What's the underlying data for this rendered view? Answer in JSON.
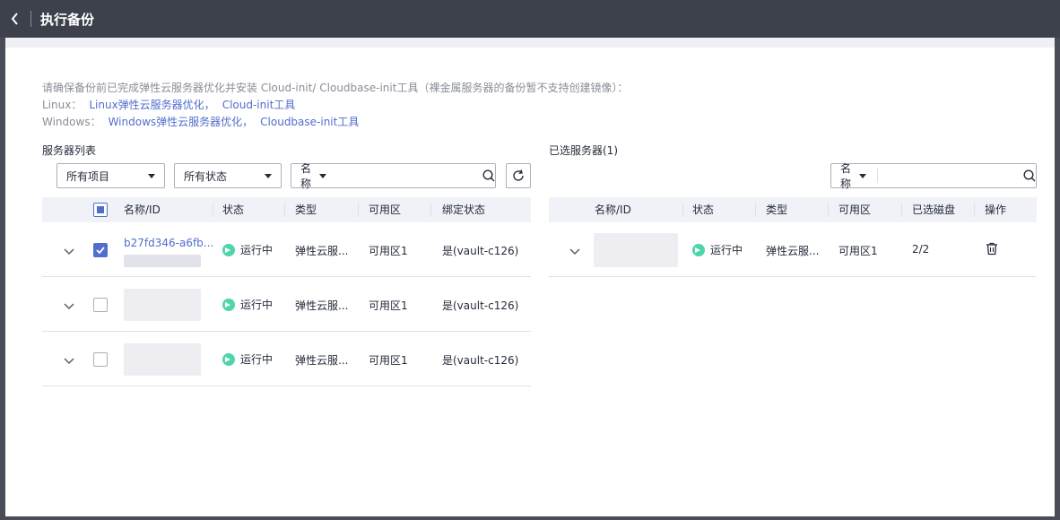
{
  "header": {
    "title": "执行备份"
  },
  "notice": {
    "line1": "请确保备份前已完成弹性云服务器优化并安装 Cloud-init/ Cloudbase-init工具（裸金属服务器的备份暂不支持创建镜像）：",
    "linux_label": "Linux：",
    "linux_link1": "Linux弹性云服务器优化，",
    "linux_link2": "Cloud-init工具",
    "windows_label": "Windows：",
    "windows_link1": "Windows弹性云服务器优化，",
    "windows_link2": "Cloudbase-init工具"
  },
  "left": {
    "title": "服务器列表",
    "project_select": "所有项目",
    "status_select": "所有状态",
    "search_field": "名称",
    "search_placeholder": "",
    "columns": [
      "名称/ID",
      "状态",
      "类型",
      "可用区",
      "绑定状态"
    ],
    "rows": [
      {
        "name": "b27fd346-a6fb...",
        "status": "运行中",
        "type": "弹性云服...",
        "az": "可用区1",
        "binding": "是(vault-c126)",
        "checked": true
      },
      {
        "name": "",
        "status": "运行中",
        "type": "弹性云服...",
        "az": "可用区1",
        "binding": "是(vault-c126)",
        "checked": false
      },
      {
        "name": "",
        "status": "运行中",
        "type": "弹性云服...",
        "az": "可用区1",
        "binding": "是(vault-c126)",
        "checked": false
      }
    ]
  },
  "right": {
    "title": "已选服务器(1)",
    "search_field": "名称",
    "search_placeholder": "",
    "columns": [
      "名称/ID",
      "状态",
      "类型",
      "可用区",
      "已选磁盘",
      "操作"
    ],
    "rows": [
      {
        "status": "运行中",
        "type": "弹性云服...",
        "az": "可用区1",
        "disks": "2/2"
      }
    ]
  },
  "colors": {
    "header_bg": "#3d414c",
    "link": "#526ecc",
    "status_running": "#50d4ab",
    "table_header_bg": "#f0f2f7"
  },
  "icons": [
    "back-arrow-icon",
    "caret-down-icon",
    "search-icon",
    "refresh-icon",
    "chevron-down-icon",
    "status-running-icon",
    "trash-icon"
  ]
}
